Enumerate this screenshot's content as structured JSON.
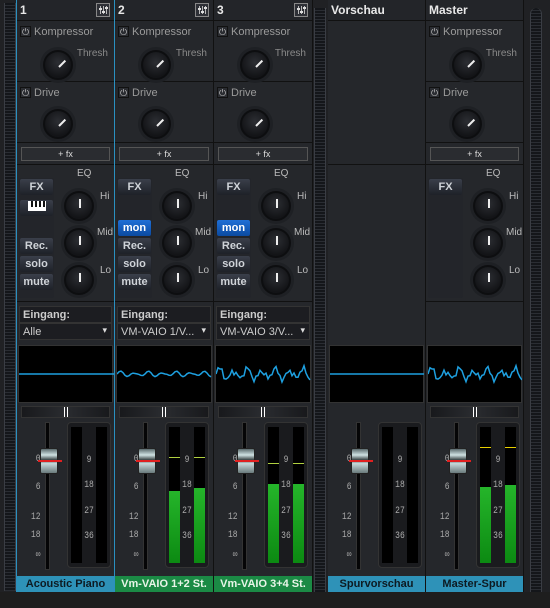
{
  "colors": {
    "accent": "#2e92b8",
    "green": "#1b8a45",
    "mon": "#1f6fd6",
    "wave": "#1ea0e0",
    "meter": "#25b52a",
    "peak_yellow": "#e8d000"
  },
  "labels": {
    "kompressor": "Kompressor",
    "thresh": "Thresh",
    "drive": "Drive",
    "add_fx": "+ fx",
    "eq": "EQ",
    "hi": "Hi",
    "mid": "Mid",
    "lo": "Lo",
    "fx": "FX",
    "mon": "mon",
    "rec": "Rec.",
    "solo": "solo",
    "mute": "mute",
    "eingang": "Eingang:",
    "chevron": "⌄"
  },
  "fader_scale": [
    "0",
    "6",
    "12",
    "18",
    "∞"
  ],
  "meter_scale": [
    "9",
    "18",
    "27",
    "36"
  ],
  "strips": [
    {
      "id": "1",
      "title": "1",
      "name": "Acoustic Piano",
      "name_color": "blue",
      "input": "Alle",
      "has_mon": false,
      "has_keyboard": true,
      "selected": true,
      "wave": "flat",
      "meter_l": 0,
      "meter_r": 0,
      "peak_l": null,
      "peak_r": null
    },
    {
      "id": "2",
      "title": "2",
      "name": "Vm-VAIO 1+2 St.",
      "name_color": "green",
      "input": "VM-VAIO 1/V...",
      "has_mon": true,
      "has_keyboard": false,
      "selected": false,
      "wave": "low",
      "meter_l": 0.53,
      "meter_r": 0.55,
      "peak_l": "9",
      "peak_r": "9"
    },
    {
      "id": "3",
      "title": "3",
      "name": "Vm-VAIO 3+4 St.",
      "name_color": "green",
      "input": "VM-VAIO 3/V...",
      "has_mon": true,
      "has_keyboard": false,
      "selected": false,
      "wave": "mid",
      "meter_l": 0.58,
      "meter_r": 0.58,
      "peak_l": "9",
      "peak_r": "9"
    },
    {
      "id": "preview",
      "title": "Vorschau",
      "name": "Spurvorschau",
      "name_color": "blue",
      "wave": "flat",
      "meter_l": 0,
      "meter_r": 0
    },
    {
      "id": "master",
      "title": "Master",
      "name": "Master-Spur",
      "name_color": "blue",
      "wave": "mid",
      "meter_l": 0.56,
      "meter_r": 0.57,
      "peak_l": "6",
      "peak_r": "6"
    }
  ]
}
